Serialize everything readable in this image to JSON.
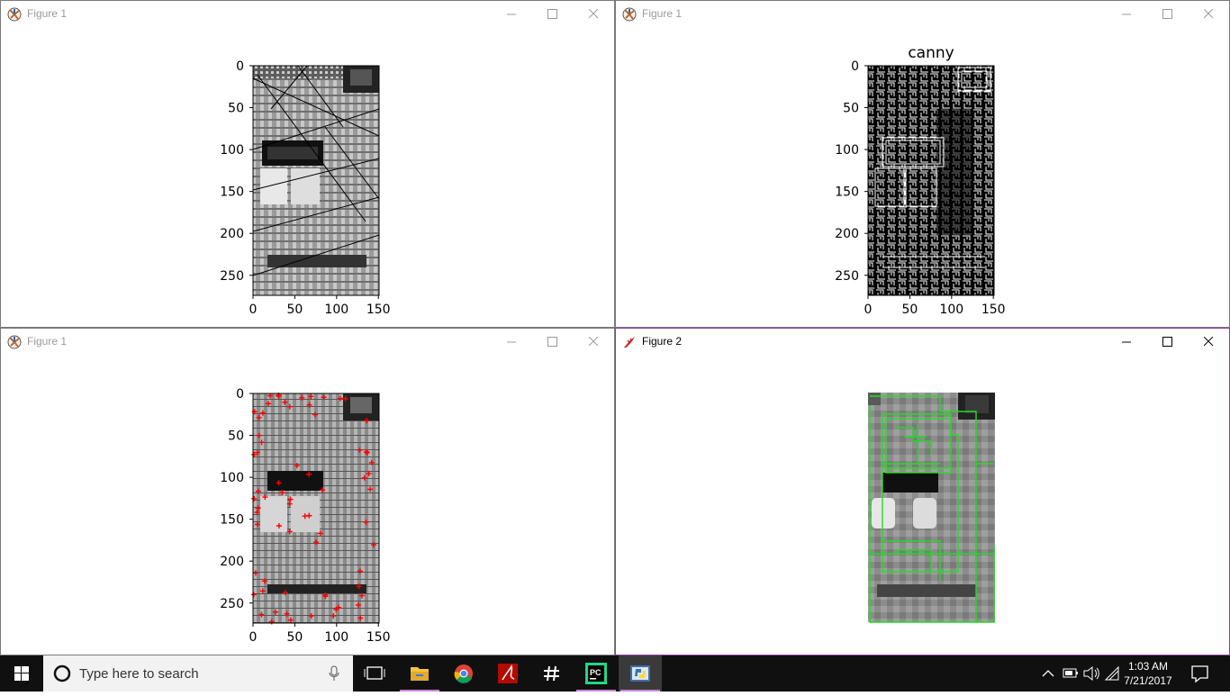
{
  "windows": [
    {
      "title": "Figure 1",
      "icon": "matplotlib-icon",
      "plot_title": "",
      "active": false
    },
    {
      "title": "Figure 1",
      "icon": "matplotlib-icon",
      "plot_title": "canny",
      "active": false
    },
    {
      "title": "Figure 1",
      "icon": "matplotlib-icon",
      "plot_title": "",
      "active": false
    },
    {
      "title": "Figure 2",
      "icon": "tk-feather-icon",
      "plot_title": "",
      "active": true
    }
  ],
  "axes": {
    "y_ticks": [
      "0",
      "50",
      "100",
      "150",
      "200",
      "250"
    ],
    "x_ticks": [
      "0",
      "50",
      "100",
      "150"
    ]
  },
  "taskbar": {
    "search_placeholder": "Type here to search",
    "apps": [
      {
        "name": "task-view-icon",
        "running": false
      },
      {
        "name": "file-explorer-icon",
        "running": true
      },
      {
        "name": "chrome-icon",
        "running": false
      },
      {
        "name": "acrobat-icon",
        "running": false
      },
      {
        "name": "slack-icon",
        "running": false
      },
      {
        "name": "pycharm-icon",
        "running": true
      },
      {
        "name": "python-icon",
        "running": true
      }
    ],
    "time": "1:03 AM",
    "date": "7/21/2017"
  },
  "colors": {
    "accent_border": "#8f3fa6",
    "corner_markers": "#ff0000",
    "contours": "#22dd22",
    "taskbar": "#101010"
  }
}
